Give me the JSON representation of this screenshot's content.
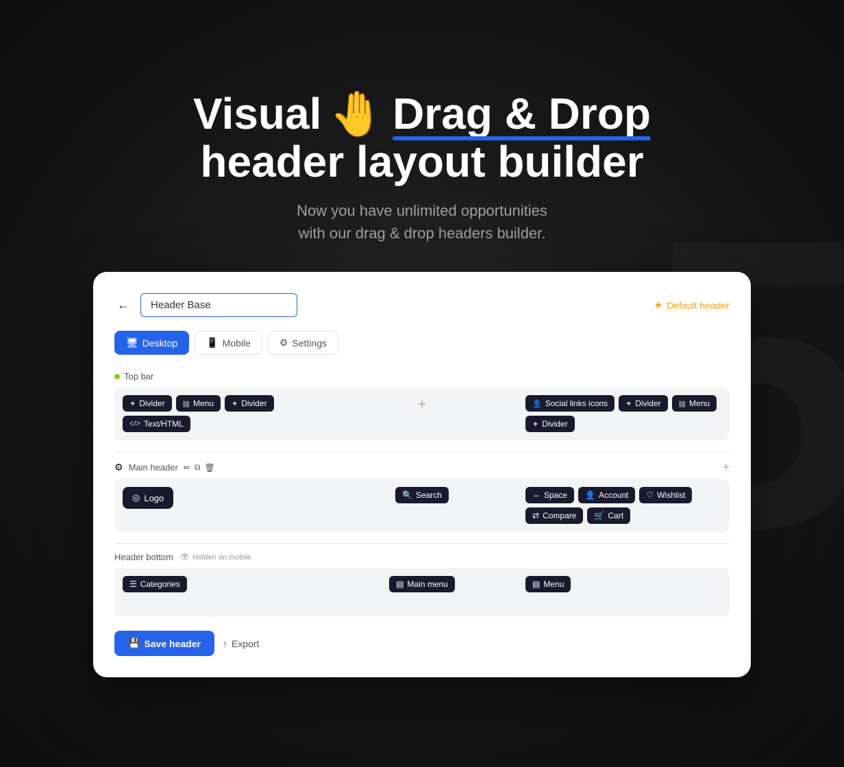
{
  "bg_number": "5",
  "hero": {
    "line1_pre": "Visual ",
    "line1_highlight": "Drag & Drop",
    "line2": "header layout builder",
    "subtitle_line1": "Now you have unlimited opportunities",
    "subtitle_line2": "with our drag & drop headers builder.",
    "hand_emoji": "🤚"
  },
  "card": {
    "back_label": "←",
    "header_name": "Header Base",
    "default_badge": "Default header",
    "star_emoji": "★",
    "tabs": [
      {
        "id": "desktop",
        "label": "Desktop",
        "icon": "🖥",
        "active": true
      },
      {
        "id": "mobile",
        "label": "Mobile",
        "icon": "📱",
        "active": false
      },
      {
        "id": "settings",
        "label": "Settings",
        "icon": "⚙",
        "active": false
      }
    ],
    "top_bar": {
      "label": "Top bar",
      "left_chips": [
        {
          "icon": "✦",
          "label": "Divider"
        },
        {
          "icon": "▤",
          "label": "Menu"
        },
        {
          "icon": "✦",
          "label": "Divider"
        },
        {
          "icon": "⟨/⟩",
          "label": "Text/HTML"
        }
      ],
      "right_chips": [
        {
          "icon": "👤",
          "label": "Social links icons"
        },
        {
          "icon": "✦",
          "label": "Divider"
        },
        {
          "icon": "▤",
          "label": "Menu"
        },
        {
          "icon": "✦",
          "label": "Divider"
        }
      ]
    },
    "main_header": {
      "label": "Main header",
      "left_chips": [
        {
          "icon": "◎",
          "label": "Logo"
        }
      ],
      "center_chips": [
        {
          "icon": "🔍",
          "label": "Search"
        }
      ],
      "right_chips": [
        {
          "icon": "⇔",
          "label": "Space"
        },
        {
          "icon": "👤",
          "label": "Account"
        },
        {
          "icon": "♡",
          "label": "Wishlist"
        },
        {
          "icon": "⇄",
          "label": "Compare"
        },
        {
          "icon": "🛒",
          "label": "Cart"
        }
      ]
    },
    "header_bottom": {
      "label": "Header bottom",
      "hidden_label": "Hidden on mobile",
      "left_chips": [
        {
          "icon": "☰",
          "label": "Categories"
        }
      ],
      "center_chips": [
        {
          "icon": "▤",
          "label": "Main menu"
        }
      ],
      "right_chips": [
        {
          "icon": "▤",
          "label": "Menu"
        }
      ]
    },
    "footer": {
      "save_label": "Save header",
      "export_label": "Export",
      "save_icon": "💾",
      "export_icon": "↑"
    }
  }
}
